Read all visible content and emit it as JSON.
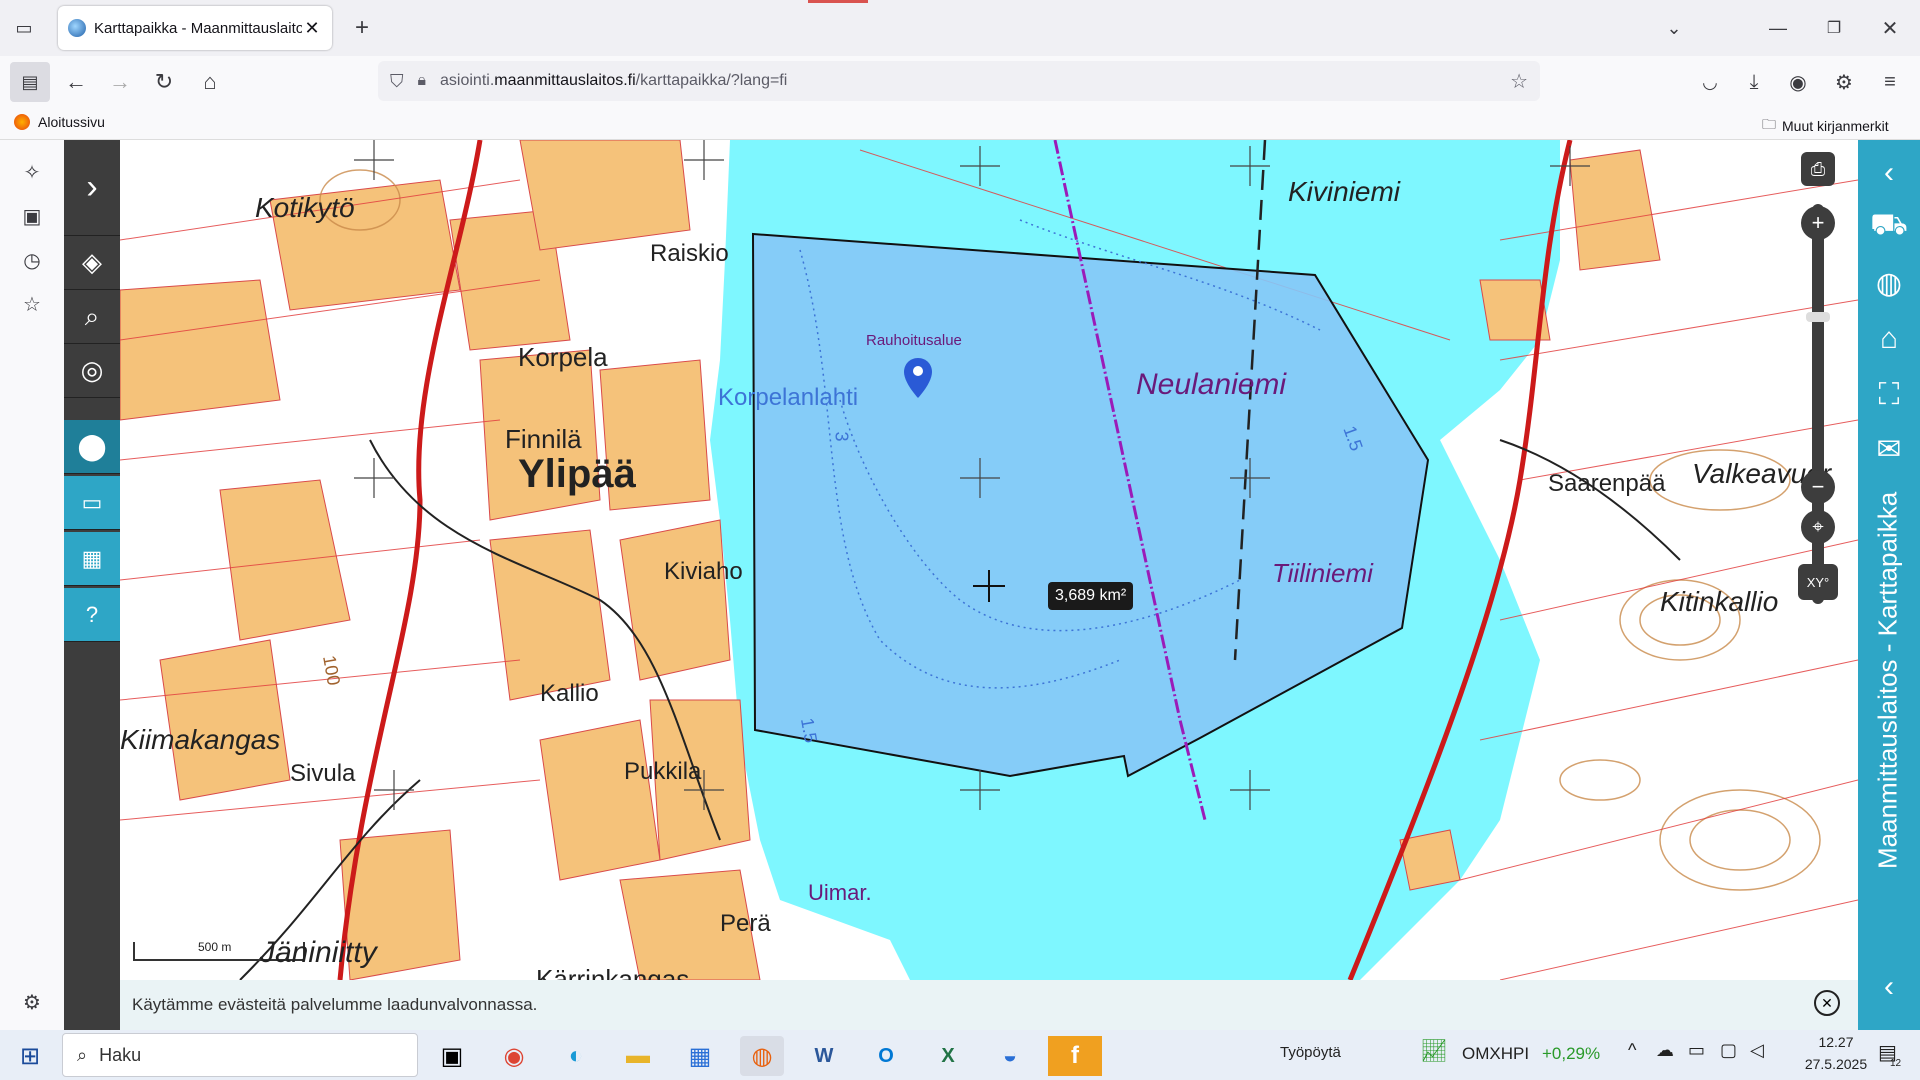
{
  "browser": {
    "tab_title": "Karttapaikka - Maanmittauslaitos",
    "new_tab": "+",
    "url_host": "asiointi.",
    "url_domain": "maanmittauslaitos.fi",
    "url_path": "/karttapaikka/?lang=fi",
    "bookmark_home": "Aloitussivu",
    "bookmark_other": "Muut kirjanmerkit"
  },
  "map": {
    "labels": {
      "kotikyto": "Kotikytö",
      "raiskio": "Raiskio",
      "korpela": "Korpela",
      "finnila": "Finnilä",
      "ylipaa": "Ylipää",
      "kiviaho": "Kiviaho",
      "kallio": "Kallio",
      "pukkila": "Pukkila",
      "kiimakangas": "Kiimakangas",
      "sivula": "Sivula",
      "pera": "Perä",
      "janiniitty": "Jäniniitty",
      "karrinkangas": "Kärrinkangas",
      "uimar": "Uimar.",
      "korpelanlahti": "Korpelanlahti",
      "rauhoitusalue": "Rauhoitusalue",
      "neulaniemi": "Neulaniemi",
      "tiiliniemi": "Tiiliniemi",
      "kiviniemi": "Kiviniemi",
      "saarenpaa": "Saarenpää",
      "valkeavuori": "Valkeavuor",
      "kitinkallio": "Kitinkallio",
      "contour_100": "100",
      "depth_15a": "1.5",
      "depth_15b": "1.5",
      "depth_3": "3"
    },
    "area_tooltip": "3,689 km²",
    "scale_label": "500 m"
  },
  "right_panel": {
    "title": "Maanmittauslaitos - Karttapaikka"
  },
  "zoom": {
    "xy_label": "XY°"
  },
  "cookie": {
    "text": "Käytämme evästeitä palvelumme laadunvalvonnassa."
  },
  "taskbar": {
    "search_placeholder": "Haku",
    "desktop_label": "Työpöytä",
    "stock_name": "OMXHPI",
    "stock_change": "+0,29%",
    "time": "12.27",
    "date": "27.5.2025",
    "notif_count": "12"
  },
  "colors": {
    "water": "#7ef7ff",
    "water_selected": "#86c7f7",
    "fields": "#f5c27a",
    "accent": "#2ea6c6"
  }
}
